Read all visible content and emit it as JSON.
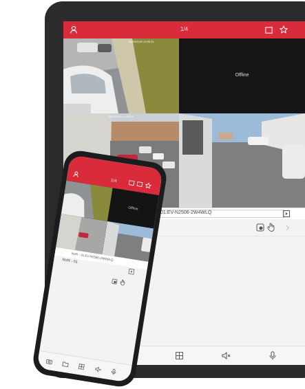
{
  "tablet": {
    "header": {
      "title": "1/4",
      "accent": "#d92b3a"
    },
    "grid": {
      "offline_label": "Offline",
      "cam_stamp_1": "00/00/2020 10:00:21",
      "cam_stamp_2": "00/00/2020 10:00:01"
    },
    "device_bar": {
      "label": "NVR - 01:EV-N2506-2W4WLQ"
    },
    "header_icons": [
      "user-icon",
      "layout-icon",
      "star-icon"
    ],
    "control_icons": [
      "capture-icon",
      "touch-icon",
      "chevron-right-icon"
    ],
    "bottom_icons": [
      "folder-icon",
      "grid-icon",
      "speaker-icon",
      "microphone-icon"
    ]
  },
  "phone": {
    "header": {
      "title": "1/4"
    },
    "grid": {
      "offline_label": "Offline"
    },
    "device_bar": {
      "label": "NVR - 01:EV-N2506-2W4WLQ"
    },
    "nvr_row": {
      "label": "NVR - 01"
    },
    "bottom_icons": [
      "camera-icon",
      "folder-icon",
      "grid-icon",
      "speaker-icon",
      "microphone-icon"
    ]
  }
}
